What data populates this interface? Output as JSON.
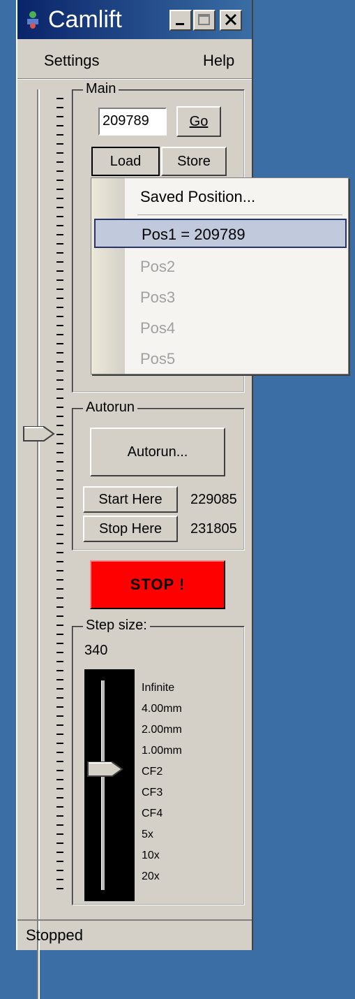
{
  "window": {
    "title": "Camlift"
  },
  "menu": {
    "items": [
      "Settings",
      "Help"
    ]
  },
  "main": {
    "legend": "Main",
    "position_value": "209789",
    "go_label": "Go",
    "load_label": "Load",
    "store_label": "Store"
  },
  "popup": {
    "header": "Saved Position...",
    "items": [
      {
        "label": "Pos1 = 209789"
      },
      {
        "label": "Pos2"
      },
      {
        "label": "Pos3"
      },
      {
        "label": "Pos4"
      },
      {
        "label": "Pos5"
      }
    ]
  },
  "autorun": {
    "legend": "Autorun",
    "autorun_label": "Autorun...",
    "start_label": "Start Here",
    "start_value": "229085",
    "stop_label": "Stop Here",
    "stop_value": "231805"
  },
  "stop_button": {
    "label": "STOP !",
    "color": "#ff0000"
  },
  "step": {
    "legend": "Step size:",
    "value": "340",
    "labels": [
      "Infinite",
      "4.00mm",
      "2.00mm",
      "1.00mm",
      "CF2",
      "CF3",
      "CF4",
      "5x",
      "10x",
      "20x"
    ],
    "selected_index": 4
  },
  "status": {
    "text": "Stopped"
  },
  "colors": {
    "desktop": "#3a6ea5",
    "window": "#d4d0c8",
    "selection": "#c1c9dc"
  }
}
